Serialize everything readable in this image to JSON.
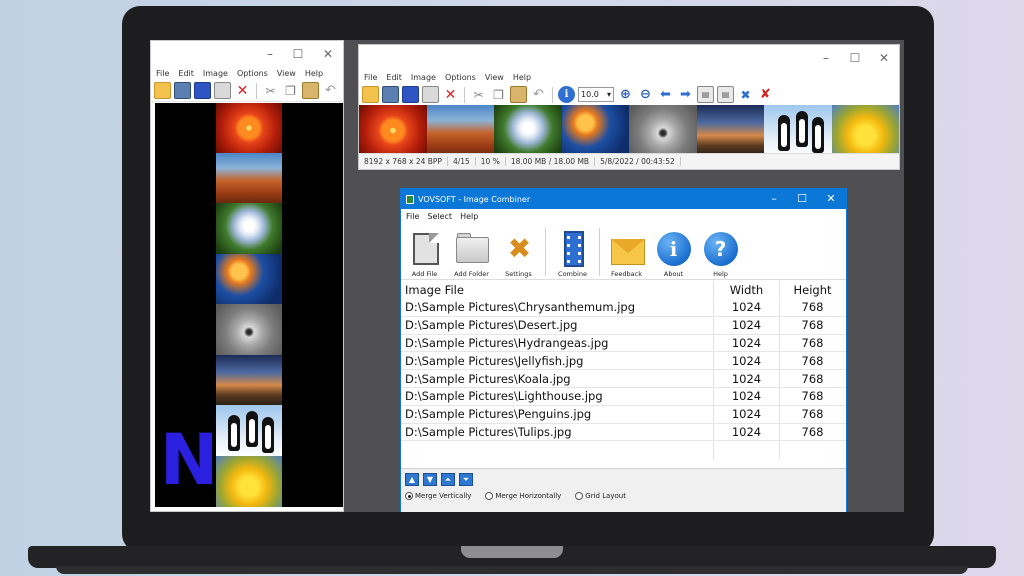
{
  "left_window": {
    "menu": [
      "File",
      "Edit",
      "Image",
      "Options",
      "View",
      "Help"
    ],
    "logo_letter": "N"
  },
  "right_window": {
    "menu": [
      "File",
      "Edit",
      "Image",
      "Options",
      "View",
      "Help"
    ],
    "zoom_value": "10.0",
    "status": [
      "8192 x 768 x 24 BPP",
      "4/15",
      "10 %",
      "18.00 MB / 18.00 MB",
      "5/8/2022 / 00:43:52"
    ]
  },
  "combiner": {
    "title": "VOVSOFT - Image Combiner",
    "menu": [
      "File",
      "Select",
      "Help"
    ],
    "toolbar": {
      "add_file": "Add File",
      "add_folder": "Add Folder",
      "settings": "Settings",
      "combine": "Combine",
      "feedback": "Feedback",
      "about": "About",
      "help": "Help"
    },
    "columns": {
      "file": "Image File",
      "width": "Width",
      "height": "Height"
    },
    "rows": [
      {
        "file": "D:\\Sample Pictures\\Chrysanthemum.jpg",
        "width": "1024",
        "height": "768"
      },
      {
        "file": "D:\\Sample Pictures\\Desert.jpg",
        "width": "1024",
        "height": "768"
      },
      {
        "file": "D:\\Sample Pictures\\Hydrangeas.jpg",
        "width": "1024",
        "height": "768"
      },
      {
        "file": "D:\\Sample Pictures\\Jellyfish.jpg",
        "width": "1024",
        "height": "768"
      },
      {
        "file": "D:\\Sample Pictures\\Koala.jpg",
        "width": "1024",
        "height": "768"
      },
      {
        "file": "D:\\Sample Pictures\\Lighthouse.jpg",
        "width": "1024",
        "height": "768"
      },
      {
        "file": "D:\\Sample Pictures\\Penguins.jpg",
        "width": "1024",
        "height": "768"
      },
      {
        "file": "D:\\Sample Pictures\\Tulips.jpg",
        "width": "1024",
        "height": "768"
      }
    ],
    "merge_options": {
      "vertical": "Merge Vertically",
      "horizontal": "Merge Horizontally",
      "grid": "Grid Layout",
      "selected": "vertical"
    }
  },
  "colors": {
    "title_blue": "#0b78d7",
    "logo_blue": "#2b20e0"
  },
  "icons": {
    "toolbar": [
      "open-folder-icon",
      "filmstrip-icon",
      "save-icon",
      "print-icon",
      "delete-icon",
      "cut-icon",
      "copy-icon",
      "paste-icon",
      "undo-icon",
      "info-icon",
      "zoom-in-icon",
      "zoom-out-icon",
      "arrow-left-icon",
      "arrow-right-icon",
      "page-prev-icon",
      "page-next-icon",
      "tools-icon",
      "exit-icon"
    ]
  }
}
